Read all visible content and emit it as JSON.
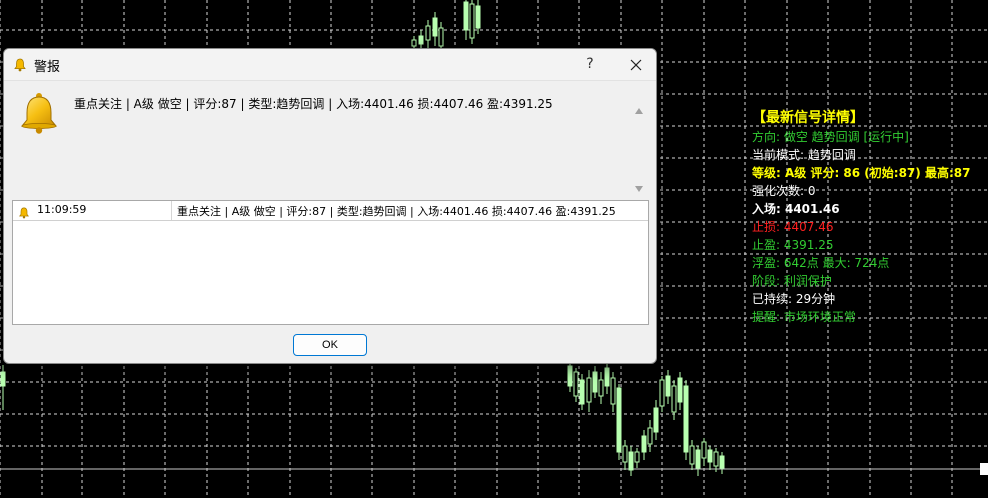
{
  "dialog": {
    "title": "警报",
    "help_label": "?",
    "message": "重点关注 | A级 做空 | 评分:87 | 类型:趋势回调 | 入场:4401.46 损:4407.46 盈:4391.25",
    "list": [
      {
        "time": "11:09:59",
        "message": "重点关注 | A级 做空 | 评分:87 | 类型:趋势回调 | 入场:4401.46 损:4407.46 盈:4391.25"
      }
    ],
    "ok_label": "OK"
  },
  "info_panel": {
    "title": "【最新信号详情】",
    "direction": "方向: 做空 趋势回调 [运行中]",
    "mode": "当前模式: 趋势回调",
    "grade": "等级: A级 评分: 86 (初始:87) 最高:87",
    "reinforce": "强化次数: 0",
    "entry": "入场: 4401.46",
    "stop_loss": "止损: 4407.46",
    "take_profit": "止盈: 4391.25",
    "floating": "浮盈: 642点 最大: 724点",
    "phase": "阶段: 利润保护",
    "duration": "已持续: 29分钟",
    "reminder": "提醒: 市场环境正常"
  },
  "colors": {
    "chart_bg": "#000000",
    "grid": "#ffffff",
    "candle": "#b8ffb0",
    "panel_green": "#32cd32",
    "panel_yellow": "#ffff00",
    "panel_red": "#ff2020",
    "dialog_bg": "#f0f0f0",
    "ok_border": "#0078d4"
  },
  "icons": {
    "title": "bell-icon",
    "message": "bell-icon",
    "row": "bell-icon",
    "close": "close-icon"
  }
}
